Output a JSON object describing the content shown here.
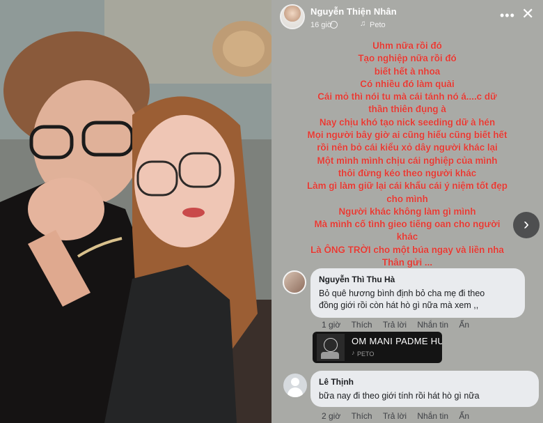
{
  "story": {
    "author": "Nguyễn Thiện Nhân",
    "time": "16 giờ",
    "music": "Peto",
    "lines": [
      "Uhm nữa rồi đó",
      "Tạo nghiệp nữa rồi đó",
      "biết hết à nhoa",
      "Có nhiều đó làm quài",
      "Cái mỏ thì nói tu mà cái tánh nó á....c dữ",
      "thần thiên đụng à",
      "Nay chịu khó tạo nick seeding dữ à hén",
      "Mọi người bây giờ ai cũng hiểu cũng biết hết",
      "rồi nên bỏ cái kiểu xỏ dây người khác lại",
      "Một mình mình chịu cái nghiệp của mình",
      "thôi đừng kéo theo người khác",
      "Làm gì làm giữ lại cái khẩu cái ý niệm tốt đẹp",
      "cho mình",
      "Người khác không làm gì mình",
      "Mà mình cố tình gieo tiếng oan cho người",
      "khác",
      "Là ÔNG TRỜI cho một búa ngay và liền nha",
      "Thân gửi ..."
    ],
    "text_color": "#e53a33",
    "background": "#a9aaa6"
  },
  "comments": [
    {
      "author": "Nguyễn Thì Thu Hà",
      "text_lines": [
        "Bỏ quê hương bình định bỏ cha mẹ đi theo",
        "đồng giới rồi còn hát hò gì nữa mà xem ,,"
      ],
      "time": "1 giờ",
      "like": "Thích",
      "reply": "Trả lời",
      "message": "Nhắn tin",
      "hide": "Ẩn",
      "attachment": {
        "title": "OM MANI PADME HUM",
        "artist": "PETO"
      }
    },
    {
      "author": "Lê Thịnh",
      "text_lines": [
        "bữa nay đi theo giới tính rồi hát hò gì nữa"
      ],
      "time": "2 giờ",
      "like": "Thích",
      "reply": "Trả lời",
      "message": "Nhắn tin",
      "hide": "Ẩn"
    }
  ],
  "icons": {
    "more": "more-horizontal-icon",
    "close": "close-icon",
    "next": "chevron-right-icon",
    "music": "music-note-icon",
    "globe": "globe-icon"
  }
}
